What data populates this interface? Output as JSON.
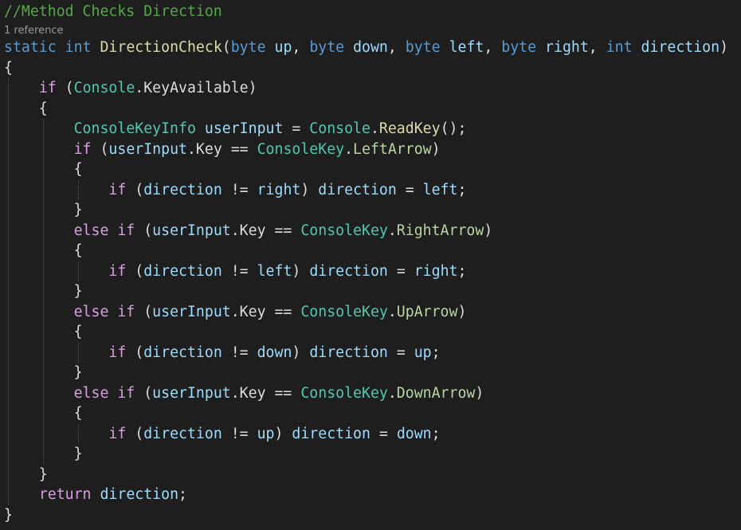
{
  "colors": {
    "background": "#1e1e1e",
    "comment": "#57a64a",
    "keyword": "#569cd6",
    "control_keyword": "#d8a0df",
    "type": "#4ec9b0",
    "method": "#dcdcaa",
    "identifier": "#9cdcfe",
    "enum_member": "#b8d7a3",
    "plain": "#dcdcdc",
    "codelens": "#999999"
  },
  "codelens": {
    "text": "1 reference"
  },
  "lines": [
    [
      [
        "cm",
        "//Method Checks Direction"
      ]
    ],
    [
      [
        "kw",
        "static"
      ],
      [
        "pl",
        " "
      ],
      [
        "kw",
        "int"
      ],
      [
        "pl",
        " "
      ],
      [
        "fn",
        "DirectionCheck"
      ],
      [
        "pl",
        "("
      ],
      [
        "kw",
        "byte"
      ],
      [
        "pl",
        " "
      ],
      [
        "pa",
        "up"
      ],
      [
        "pl",
        ", "
      ],
      [
        "kw",
        "byte"
      ],
      [
        "pl",
        " "
      ],
      [
        "pa",
        "down"
      ],
      [
        "pl",
        ", "
      ],
      [
        "kw",
        "byte"
      ],
      [
        "pl",
        " "
      ],
      [
        "pa",
        "left"
      ],
      [
        "pl",
        ", "
      ],
      [
        "kw",
        "byte"
      ],
      [
        "pl",
        " "
      ],
      [
        "pa",
        "right"
      ],
      [
        "pl",
        ", "
      ],
      [
        "kw",
        "int"
      ],
      [
        "pl",
        " "
      ],
      [
        "pa",
        "direction"
      ],
      [
        "pl",
        ")"
      ]
    ],
    [
      [
        "pl",
        "{"
      ]
    ],
    [
      [
        "pl",
        "    "
      ],
      [
        "kw2",
        "if"
      ],
      [
        "pl",
        " ("
      ],
      [
        "ty",
        "Console"
      ],
      [
        "pl",
        ".KeyAvailable)"
      ]
    ],
    [
      [
        "pl",
        "    {"
      ]
    ],
    [
      [
        "pl",
        "        "
      ],
      [
        "ty",
        "ConsoleKeyInfo"
      ],
      [
        "pl",
        " "
      ],
      [
        "pa",
        "userInput"
      ],
      [
        "pl",
        " = "
      ],
      [
        "ty",
        "Console"
      ],
      [
        "pl",
        "."
      ],
      [
        "fn",
        "ReadKey"
      ],
      [
        "pl",
        "();"
      ]
    ],
    [
      [
        "pl",
        "        "
      ],
      [
        "kw2",
        "if"
      ],
      [
        "pl",
        " ("
      ],
      [
        "pa",
        "userInput"
      ],
      [
        "pl",
        ".Key == "
      ],
      [
        "ty",
        "ConsoleKey"
      ],
      [
        "pl",
        "."
      ],
      [
        "en",
        "LeftArrow"
      ],
      [
        "pl",
        ")"
      ]
    ],
    [
      [
        "pl",
        "        {"
      ]
    ],
    [
      [
        "pl",
        "            "
      ],
      [
        "kw2",
        "if"
      ],
      [
        "pl",
        " ("
      ],
      [
        "pa",
        "direction"
      ],
      [
        "pl",
        " != "
      ],
      [
        "pa",
        "right"
      ],
      [
        "pl",
        ") "
      ],
      [
        "pa",
        "direction"
      ],
      [
        "pl",
        " = "
      ],
      [
        "pa",
        "left"
      ],
      [
        "pl",
        ";"
      ]
    ],
    [
      [
        "pl",
        "        }"
      ]
    ],
    [
      [
        "pl",
        "        "
      ],
      [
        "kw2",
        "else if"
      ],
      [
        "pl",
        " ("
      ],
      [
        "pa",
        "userInput"
      ],
      [
        "pl",
        ".Key == "
      ],
      [
        "ty",
        "ConsoleKey"
      ],
      [
        "pl",
        "."
      ],
      [
        "en",
        "RightArrow"
      ],
      [
        "pl",
        ")"
      ]
    ],
    [
      [
        "pl",
        "        {"
      ]
    ],
    [
      [
        "pl",
        "            "
      ],
      [
        "kw2",
        "if"
      ],
      [
        "pl",
        " ("
      ],
      [
        "pa",
        "direction"
      ],
      [
        "pl",
        " != "
      ],
      [
        "pa",
        "left"
      ],
      [
        "pl",
        ") "
      ],
      [
        "pa",
        "direction"
      ],
      [
        "pl",
        " = "
      ],
      [
        "pa",
        "right"
      ],
      [
        "pl",
        ";"
      ]
    ],
    [
      [
        "pl",
        "        }"
      ]
    ],
    [
      [
        "pl",
        "        "
      ],
      [
        "kw2",
        "else if"
      ],
      [
        "pl",
        " ("
      ],
      [
        "pa",
        "userInput"
      ],
      [
        "pl",
        ".Key == "
      ],
      [
        "ty",
        "ConsoleKey"
      ],
      [
        "pl",
        "."
      ],
      [
        "en",
        "UpArrow"
      ],
      [
        "pl",
        ")"
      ]
    ],
    [
      [
        "pl",
        "        {"
      ]
    ],
    [
      [
        "pl",
        "            "
      ],
      [
        "kw2",
        "if"
      ],
      [
        "pl",
        " ("
      ],
      [
        "pa",
        "direction"
      ],
      [
        "pl",
        " != "
      ],
      [
        "pa",
        "down"
      ],
      [
        "pl",
        ") "
      ],
      [
        "pa",
        "direction"
      ],
      [
        "pl",
        " = "
      ],
      [
        "pa",
        "up"
      ],
      [
        "pl",
        ";"
      ]
    ],
    [
      [
        "pl",
        "        }"
      ]
    ],
    [
      [
        "pl",
        "        "
      ],
      [
        "kw2",
        "else if"
      ],
      [
        "pl",
        " ("
      ],
      [
        "pa",
        "userInput"
      ],
      [
        "pl",
        ".Key == "
      ],
      [
        "ty",
        "ConsoleKey"
      ],
      [
        "pl",
        "."
      ],
      [
        "en",
        "DownArrow"
      ],
      [
        "pl",
        ")"
      ]
    ],
    [
      [
        "pl",
        "        {"
      ]
    ],
    [
      [
        "pl",
        "            "
      ],
      [
        "kw2",
        "if"
      ],
      [
        "pl",
        " ("
      ],
      [
        "pa",
        "direction"
      ],
      [
        "pl",
        " != "
      ],
      [
        "pa",
        "up"
      ],
      [
        "pl",
        ") "
      ],
      [
        "pa",
        "direction"
      ],
      [
        "pl",
        " = "
      ],
      [
        "pa",
        "down"
      ],
      [
        "pl",
        ";"
      ]
    ],
    [
      [
        "pl",
        "        }"
      ]
    ],
    [
      [
        "pl",
        "    }"
      ]
    ],
    [
      [
        "pl",
        "    "
      ],
      [
        "kw2",
        "return"
      ],
      [
        "pl",
        " "
      ],
      [
        "pa",
        "direction"
      ],
      [
        "pl",
        ";"
      ]
    ],
    [
      [
        "pl",
        "}"
      ]
    ]
  ]
}
